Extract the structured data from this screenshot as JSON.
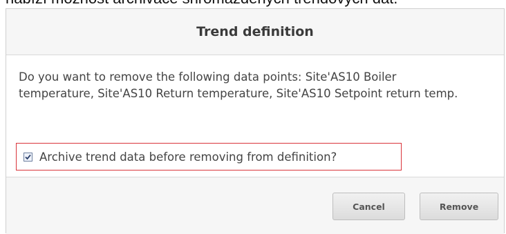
{
  "caption": "nabízí možnost archivace shromážděných trendových dat.",
  "dialog": {
    "title": "Trend definition",
    "message": "Do you want to remove the following data points: Site'AS10 Boiler temperature, Site'AS10 Return temperature, Site'AS10 Setpoint return temp.",
    "archive_checkbox": {
      "label": "Archive trend data before removing from definition?",
      "checked": true
    },
    "buttons": {
      "cancel": "Cancel",
      "remove": "Remove"
    }
  },
  "colors": {
    "highlight_border": "#d9333a",
    "dialog_background": "#f6f6f6"
  }
}
